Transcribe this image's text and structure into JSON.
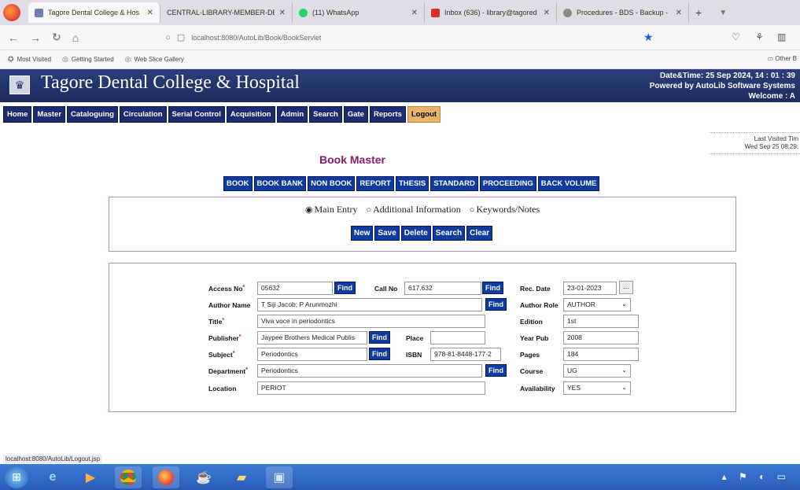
{
  "browser": {
    "tabs": [
      {
        "title": "Tagore Dental College & Hos",
        "active": true,
        "icon_color": "#6c7fb0"
      },
      {
        "title": "CENTRAL-LIBRARY-MEMBER-DET",
        "active": false,
        "icon_color": "#dedee6"
      },
      {
        "title": "(11) WhatsApp",
        "active": false,
        "icon_color": "#25d366"
      },
      {
        "title": "Inbox (636) - library@tagored",
        "active": false,
        "icon_color": "#d93025"
      },
      {
        "title": "Procedures - BDS - Backup -",
        "active": false,
        "icon_color": "#8a8a8a"
      }
    ],
    "url": "localhost:8080/AutoLib/Book/BookServlet",
    "bookmarks": [
      "Most Visited",
      "Getting Started",
      "Web Slice Gallery"
    ],
    "other_bookmarks": "Other B",
    "status_url": "localhost:8080/AutoLib/Logout.jsp"
  },
  "header": {
    "college": "Tagore Dental College & Hospital",
    "datetime": "Date&Time:  25 Sep 2024, 14 : 01 : 39",
    "powered": "Powered by AutoLib Software Systems",
    "welcome": "Welcome  :  A"
  },
  "menu": [
    "Home",
    "Master",
    "Cataloguing",
    "Circulation",
    "Serial Control",
    "Acquisition",
    "Admin",
    "Search",
    "Gate",
    "Reports",
    "Logout"
  ],
  "last_visited": {
    "label": "Last Visited Tim",
    "value": "Wed Sep 25 08:29:"
  },
  "page_title": "Book Master",
  "types": [
    "BOOK",
    "BOOK BANK",
    "NON BOOK",
    "REPORT",
    "THESIS",
    "STANDARD",
    "PROCEEDING",
    "BACK VOLUME"
  ],
  "radios": [
    {
      "label": "Main Entry",
      "checked": true
    },
    {
      "label": "Additional Information",
      "checked": false
    },
    {
      "label": "Keywords/Notes",
      "checked": false
    }
  ],
  "actions": [
    "New",
    "Save",
    "Delete",
    "Search",
    "Clear"
  ],
  "find_label": "Find",
  "dots_label": "...",
  "form": {
    "access_no": {
      "label": "Access No",
      "value": "05632"
    },
    "call_no": {
      "label": "Call No",
      "value": "617.632"
    },
    "rec_date": {
      "label": "Rec. Date",
      "value": "23-01-2023"
    },
    "author_name": {
      "label": "Author Name",
      "value": "T Siji Jacob; P Arunmozhi"
    },
    "author_role": {
      "label": "Author Role",
      "value": "AUTHOR"
    },
    "title": {
      "label": "Title",
      "value": "Viva voce in periodontics"
    },
    "edition": {
      "label": "Edition",
      "value": "1st"
    },
    "publisher": {
      "label": "Publisher",
      "value": "Jaypee Brothers Medical Publis"
    },
    "place": {
      "label": "Place",
      "value": ""
    },
    "year_pub": {
      "label": "Year Pub",
      "value": "2008"
    },
    "subject": {
      "label": "Subject",
      "value": "Periodontics"
    },
    "isbn": {
      "label": "ISBN",
      "value": "978-81-8448-177-2"
    },
    "pages": {
      "label": "Pages",
      "value": "184"
    },
    "department": {
      "label": "Department",
      "value": "Periodontics"
    },
    "course": {
      "label": "Course",
      "value": "UG"
    },
    "location": {
      "label": "Location",
      "value": "PERIOT"
    },
    "availability": {
      "label": "Availability",
      "value": "YES"
    }
  },
  "taskbar": [
    "start-button",
    "ie-icon",
    "media-icon",
    "chrome-icon",
    "firefox-icon",
    "java-icon",
    "folder-icon",
    "app-icon"
  ]
}
